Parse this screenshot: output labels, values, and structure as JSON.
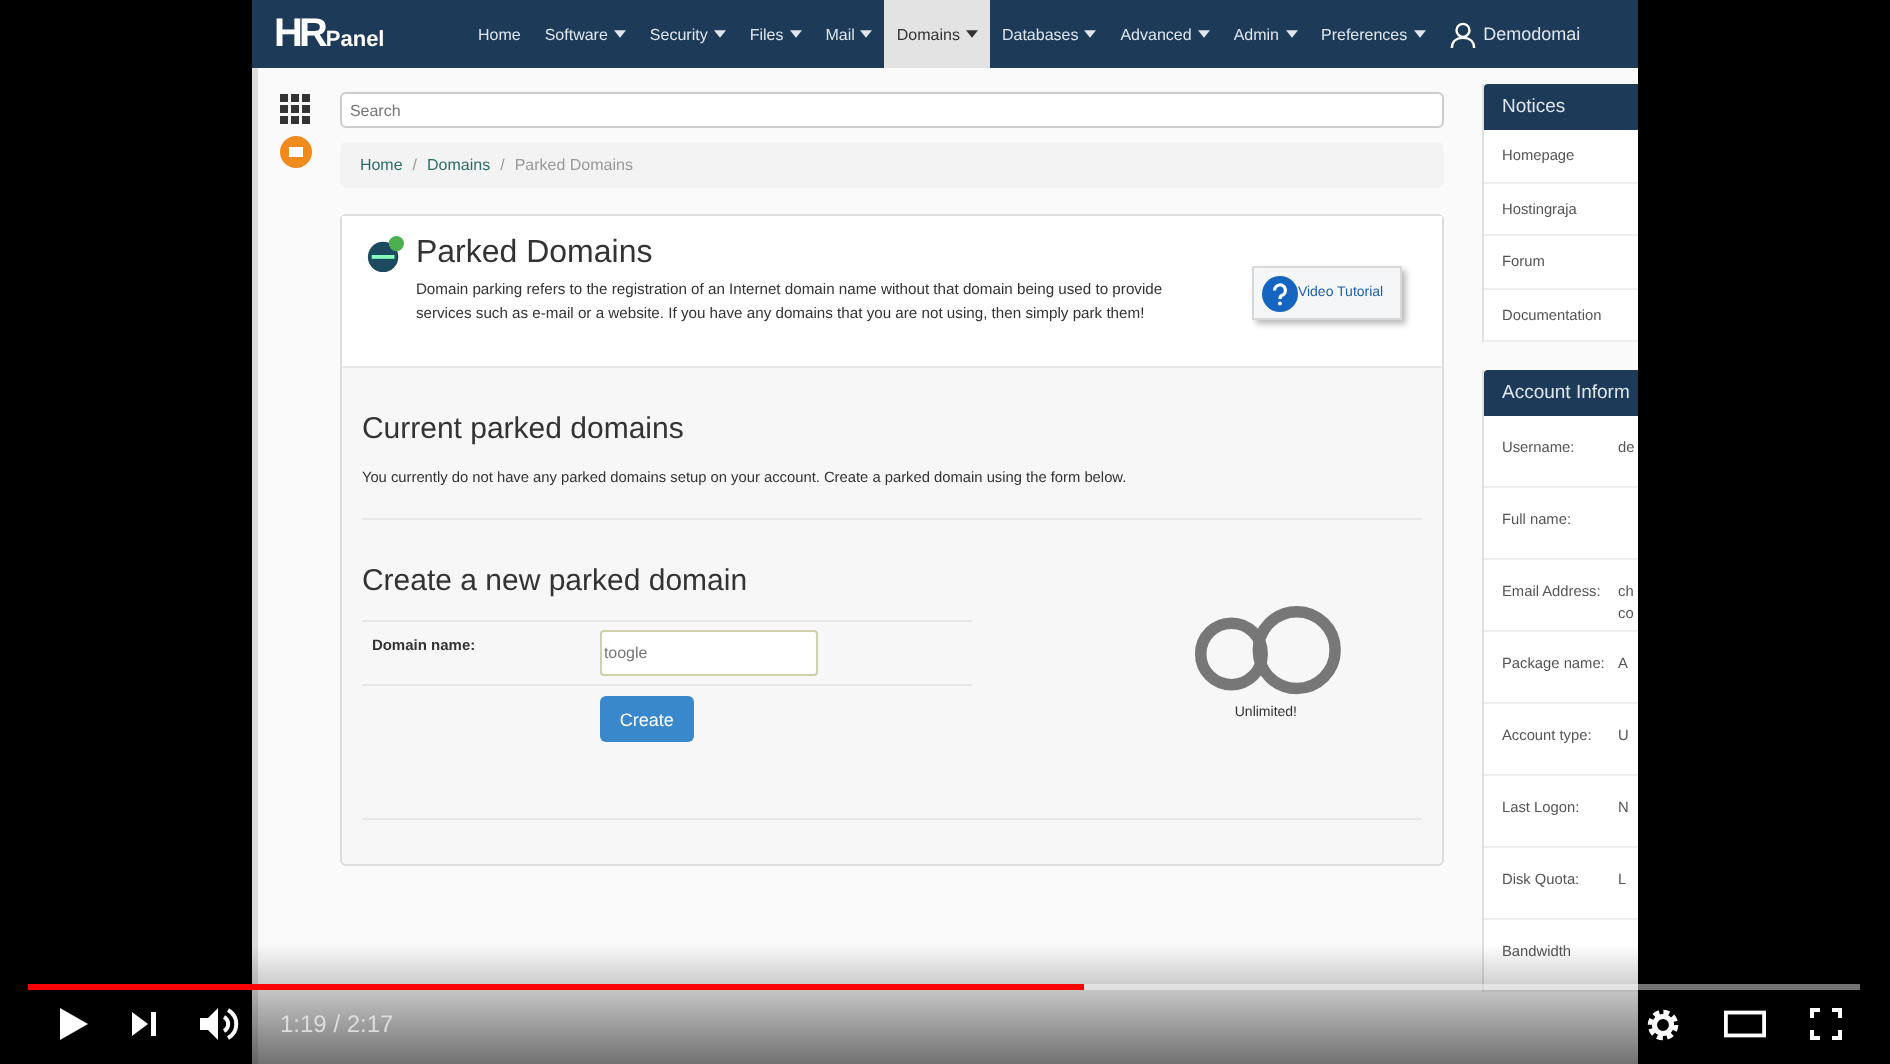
{
  "app": {
    "logo": {
      "mark": "HR",
      "text": "Panel"
    },
    "nav": [
      {
        "label": "Home",
        "dropdown": false,
        "selected": false
      },
      {
        "label": "Software",
        "dropdown": true,
        "selected": false
      },
      {
        "label": "Security",
        "dropdown": true,
        "selected": false
      },
      {
        "label": "Files",
        "dropdown": true,
        "selected": false
      },
      {
        "label": "Mail",
        "dropdown": true,
        "selected": false
      },
      {
        "label": "Domains",
        "dropdown": true,
        "selected": true
      },
      {
        "label": "Databases",
        "dropdown": true,
        "selected": false
      },
      {
        "label": "Advanced",
        "dropdown": true,
        "selected": false
      },
      {
        "label": "Admin",
        "dropdown": true,
        "selected": false
      },
      {
        "label": "Preferences",
        "dropdown": true,
        "selected": false
      }
    ],
    "user": "Demodomai",
    "search": {
      "placeholder": "Search"
    },
    "breadcrumb_separator": "/",
    "breadcrumb": [
      {
        "label": "Home",
        "current": false
      },
      {
        "label": "Domains",
        "current": false
      },
      {
        "label": "Parked Domains",
        "current": true
      }
    ],
    "page": {
      "title": "Parked Domains",
      "description": "Domain parking refers to the registration of an Internet domain name without that domain being used to provide services such as e-mail or a website. If you have any domains that you are not using, then simply park them!",
      "video_button": "Video Tutorial"
    },
    "current": {
      "heading": "Current parked domains",
      "message": "You currently do not have any parked domains setup on your account. Create a parked domain using the form below."
    },
    "create": {
      "heading": "Create a new parked domain",
      "label": "Domain name:",
      "value": "toogle",
      "button": "Create",
      "limit": "Unlimited!"
    },
    "sidebar": {
      "notices": {
        "title": "Notices",
        "links": [
          "Homepage",
          "Hostingraja",
          "Forum",
          "Documentation"
        ]
      },
      "account": {
        "title": "Account Inform",
        "rows": [
          {
            "label": "Username:",
            "value": "de"
          },
          {
            "label": "Full name:"
          },
          {
            "label": "Email Address:",
            "value": "ch co"
          },
          {
            "label": "Package name:",
            "value": "A"
          },
          {
            "label": "Account type:",
            "value": "U"
          },
          {
            "label": "Last Logon:",
            "value": "N"
          },
          {
            "label": "Disk Quota:",
            "value": "L"
          },
          {
            "label": "Bandwidth"
          }
        ]
      }
    }
  },
  "player": {
    "progress": {
      "level": 0.576
    },
    "time": "1:19 / 2:17"
  }
}
